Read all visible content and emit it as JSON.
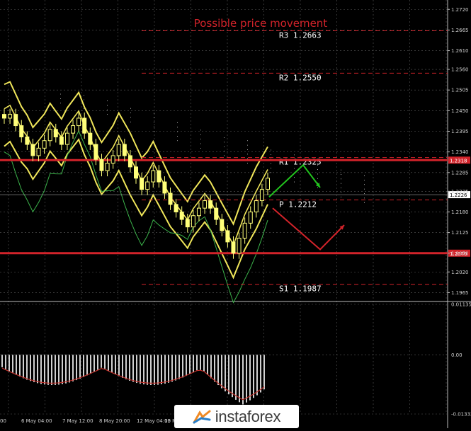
{
  "chart_data": [
    {
      "type": "line",
      "title": "Possible price movement",
      "ylim": [
        1.1945,
        1.2745
      ],
      "yticks": [
        "1.2720",
        "1.2665",
        "1.2610",
        "1.2560",
        "1.2505",
        "1.2450",
        "1.2395",
        "1.2340",
        "1.2285",
        "1.2235",
        "1.2180",
        "1.2125",
        "1.2070",
        "1.2020",
        "1.1965"
      ],
      "xticks": [
        "00",
        "6 May 04:00",
        "7 May 12:00",
        "8 May 20:00",
        "12 May 04:00",
        "13 Ma"
      ],
      "current_price": "1.2226",
      "levels": [
        {
          "name": "R3",
          "label": "R3 1.2663",
          "value": 1.2663,
          "style": "dashed"
        },
        {
          "name": "R2",
          "label": "R2 1.2550",
          "value": 1.255,
          "style": "dashed"
        },
        {
          "name": "R1",
          "label": "R1 1.2325",
          "value": 1.2325,
          "style": "dashed"
        },
        {
          "name": "P",
          "label": "P 1.2212",
          "value": 1.2212,
          "style": "dashed"
        },
        {
          "name": "S1",
          "label": "S1 1.1987",
          "value": 1.1987,
          "style": "dashed"
        }
      ],
      "horizontal_lines": [
        {
          "value": 1.2318,
          "box": "1.2318"
        },
        {
          "value": 1.207,
          "box": "1.2070"
        }
      ],
      "candles_close": [
        1.243,
        1.244,
        1.241,
        1.238,
        1.236,
        1.233,
        1.235,
        1.237,
        1.24,
        1.238,
        1.236,
        1.239,
        1.241,
        1.243,
        1.239,
        1.236,
        1.232,
        1.229,
        1.231,
        1.233,
        1.236,
        1.233,
        1.23,
        1.227,
        1.224,
        1.226,
        1.229,
        1.226,
        1.223,
        1.22,
        1.218,
        1.216,
        1.214,
        1.217,
        1.219,
        1.221,
        1.219,
        1.216,
        1.213,
        1.21,
        1.207,
        1.211,
        1.215,
        1.218,
        1.221,
        1.224,
        1.227
      ]
    },
    {
      "type": "bar",
      "ylim": [
        -0.01332,
        0.01135
      ],
      "yticks": [
        "0.01135",
        "0.00",
        "-0.01332"
      ]
    }
  ],
  "brand": "instaforex",
  "colors": {
    "background": "#000000",
    "grid": "#5a5a5a",
    "candle": "#ffff7a",
    "bollinger": "#f0e65a",
    "cloud": "#ffffff",
    "levels": "#d2232a",
    "arrow_up": "#22c51e",
    "arrow_down": "#d2232a",
    "green_line": "#3bb24a",
    "histogram": "#e8e8e8",
    "signal": "#c0302a"
  }
}
